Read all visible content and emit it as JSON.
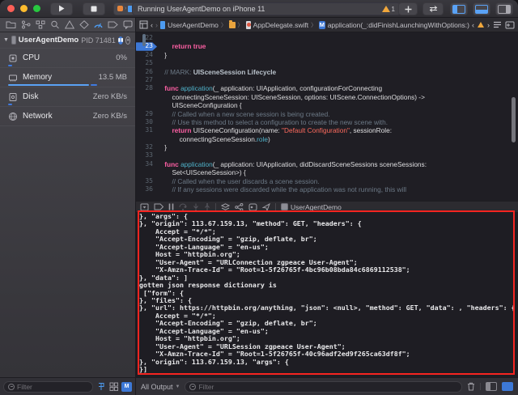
{
  "titlebar": {
    "status_text": "Running UserAgentDemo on iPhone 11",
    "warning_count": "1",
    "scheme_device": "iP…1"
  },
  "navigator": {
    "process": {
      "name": "UserAgentDemo",
      "pid_label": "PID 71481"
    },
    "gauges": [
      {
        "label": "CPU",
        "value": "0%"
      },
      {
        "label": "Memory",
        "value": "13.5 MB"
      },
      {
        "label": "Disk",
        "value": "Zero KB/s"
      },
      {
        "label": "Network",
        "value": "Zero KB/s"
      }
    ],
    "filter_placeholder": "Filter"
  },
  "jumpbar": {
    "back": "‹",
    "forward": "›",
    "project": "UserAgentDemo",
    "file": "AppDelegate.swift",
    "method_badge": "M",
    "symbol": "application(_:didFinishLaunchingWithOptions:)"
  },
  "editor": {
    "lines": [
      {
        "num": "22",
        "segs": []
      },
      {
        "num": "23",
        "bp": true,
        "segs": [
          [
            "        "
          ],
          [
            "return",
            "k"
          ],
          [
            " "
          ],
          [
            "true",
            "k"
          ]
        ]
      },
      {
        "num": "24",
        "segs": [
          [
            "    }"
          ]
        ]
      },
      {
        "num": "25",
        "segs": []
      },
      {
        "num": "26",
        "segs": [
          [
            "    "
          ],
          [
            "// MARK: ",
            "c"
          ],
          [
            "UISceneSession Lifecycle",
            "m"
          ]
        ]
      },
      {
        "num": "27",
        "segs": []
      },
      {
        "num": "28",
        "segs": [
          [
            "    "
          ],
          [
            "func",
            "k"
          ],
          [
            " "
          ],
          [
            "application",
            "f"
          ],
          [
            "(_ application: UIApplication, configurationForConnecting"
          ]
        ]
      },
      {
        "num": "",
        "segs": [
          [
            "        connectingSceneSession: UISceneSession, options: UIScene.ConnectionOptions) ->"
          ]
        ]
      },
      {
        "num": "",
        "segs": [
          [
            "        UISceneConfiguration {"
          ]
        ]
      },
      {
        "num": "29",
        "segs": [
          [
            "        "
          ],
          [
            "// Called when a new scene session is being created.",
            "c"
          ]
        ]
      },
      {
        "num": "30",
        "segs": [
          [
            "        "
          ],
          [
            "// Use this method to select a configuration to create the new scene with.",
            "c"
          ]
        ]
      },
      {
        "num": "31",
        "segs": [
          [
            "        "
          ],
          [
            "return",
            "k"
          ],
          [
            " UISceneConfiguration(name: "
          ],
          [
            "\"Default Configuration\"",
            "s"
          ],
          [
            ", sessionRole:"
          ]
        ]
      },
      {
        "num": "",
        "segs": [
          [
            "            connectingSceneSession."
          ],
          [
            "role",
            "f"
          ],
          [
            ")"
          ]
        ]
      },
      {
        "num": "32",
        "segs": [
          [
            "    }"
          ]
        ]
      },
      {
        "num": "33",
        "segs": []
      },
      {
        "num": "34",
        "segs": [
          [
            "    "
          ],
          [
            "func",
            "k"
          ],
          [
            " "
          ],
          [
            "application",
            "f"
          ],
          [
            "(_ application: UIApplication, didDiscardSceneSessions sceneSessions:"
          ]
        ]
      },
      {
        "num": "",
        "segs": [
          [
            "        Set<UISceneSession>) {"
          ]
        ]
      },
      {
        "num": "35",
        "segs": [
          [
            "        "
          ],
          [
            "// Called when the user discards a scene session.",
            "c"
          ]
        ]
      },
      {
        "num": "36",
        "segs": [
          [
            "        "
          ],
          [
            "// If any sessions were discarded while the application was not running, this will",
            "c"
          ]
        ]
      }
    ]
  },
  "debugbar": {
    "process_label": "UserAgentDemo"
  },
  "console": {
    "lines": [
      "}, \"args\": {",
      "}, \"origin\": 113.67.159.13, \"method\": GET, \"headers\": {",
      "    Accept = \"*/*\";",
      "    \"Accept-Encoding\" = \"gzip, deflate, br\";",
      "    \"Accept-Language\" = \"en-us\";",
      "    Host = \"httpbin.org\";",
      "    \"User-Agent\" = \"URLConnection zgpeace User-Agent\";",
      "    \"X-Amzn-Trace-Id\" = \"Root=1-5f26765f-4bc96b08bda84c6869112538\";",
      "}, \"data\": ]",
      "gotten json response dictionary is",
      " [\"form\": {",
      "}, \"files\": {",
      "}, \"url\": https://httpbin.org/anything, \"json\": <null>, \"method\": GET, \"data\": , \"headers\": {",
      "    Accept = \"*/*\";",
      "    \"Accept-Encoding\" = \"gzip, deflate, br\";",
      "    \"Accept-Language\" = \"en-us\";",
      "    Host = \"httpbin.org\";",
      "    \"User-Agent\" = \"URLSession zgpeace User-Agent\";",
      "    \"X-Amzn-Trace-Id\" = \"Root=1-5f26765f-40c96adf2ed9f265ca63df8f\";",
      "}, \"origin\": 113.67.159.13, \"args\": {",
      "}]"
    ]
  },
  "console_bottombar": {
    "scope_label": "All Output",
    "filter_placeholder": "Filter"
  },
  "colors": {
    "accent_blue": "#4d9bf0",
    "breakpoint_blue": "#3d78d6",
    "warning_orange": "#f0a73c",
    "annotation_red": "#f52420",
    "keyword_pink": "#fc5fa3",
    "string_red": "#fc6a5d",
    "comment_gray": "#6c7986",
    "function_teal": "#4fb2c9"
  }
}
